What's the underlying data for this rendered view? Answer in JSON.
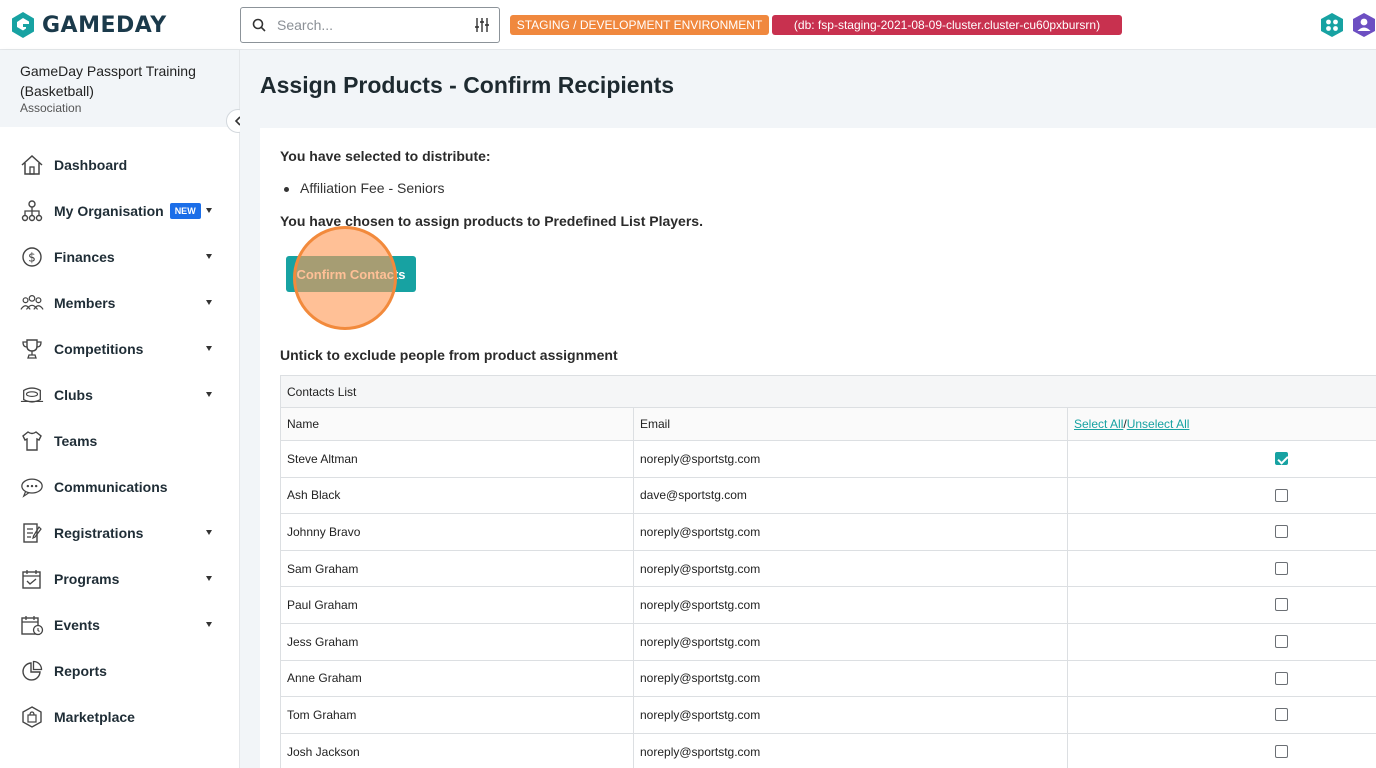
{
  "app": {
    "logo_text": "GAMEDAY"
  },
  "search": {
    "placeholder": "Search..."
  },
  "env": {
    "environment_label": "STAGING / DEVELOPMENT ENVIRONMENT",
    "db_label": "(db: fsp-staging-2021-08-09-cluster.cluster-cu60pxbursrn)"
  },
  "org": {
    "name": "GameDay Passport Training (Basketball)",
    "type": "Association"
  },
  "sidebar": {
    "items": [
      {
        "label": "Dashboard",
        "icon": "home-icon",
        "has_caret": false
      },
      {
        "label": "My Organisation",
        "icon": "org-chart-icon",
        "has_caret": true,
        "badge": "NEW"
      },
      {
        "label": "Finances",
        "icon": "dollar-circle-icon",
        "has_caret": true
      },
      {
        "label": "Members",
        "icon": "members-icon",
        "has_caret": true
      },
      {
        "label": "Competitions",
        "icon": "trophy-icon",
        "has_caret": true
      },
      {
        "label": "Clubs",
        "icon": "stadium-icon",
        "has_caret": true
      },
      {
        "label": "Teams",
        "icon": "jersey-icon",
        "has_caret": false
      },
      {
        "label": "Communications",
        "icon": "chat-icon",
        "has_caret": false
      },
      {
        "label": "Registrations",
        "icon": "registration-icon",
        "has_caret": true
      },
      {
        "label": "Programs",
        "icon": "calendar-icon",
        "has_caret": true
      },
      {
        "label": "Events",
        "icon": "event-calendar-icon",
        "has_caret": true
      },
      {
        "label": "Reports",
        "icon": "pie-chart-icon",
        "has_caret": false
      },
      {
        "label": "Marketplace",
        "icon": "shopping-bag-icon",
        "has_caret": false
      }
    ]
  },
  "main": {
    "title": "Assign Products - Confirm Recipients",
    "selected_text": "You have selected to distribute:",
    "selected_items": [
      "Affiliation Fee - Seniors"
    ],
    "chosen_text": "You have chosen to assign products to Predefined List Players.",
    "confirm_button": "Confirm Contacts",
    "untick_text": "Untick to exclude people from product assignment"
  },
  "contacts_table": {
    "caption": "Contacts List",
    "headers": {
      "name": "Name",
      "email": "Email",
      "select_all": "Select All",
      "separator": "/",
      "unselect_all": "Unselect All"
    },
    "rows": [
      {
        "name": "Steve Altman",
        "email": "noreply@sportstg.com",
        "checked": true
      },
      {
        "name": "Ash Black",
        "email": "dave@sportstg.com",
        "checked": false
      },
      {
        "name": "Johnny Bravo",
        "email": "noreply@sportstg.com",
        "checked": false
      },
      {
        "name": "Sam Graham",
        "email": "noreply@sportstg.com",
        "checked": false
      },
      {
        "name": "Paul Graham",
        "email": "noreply@sportstg.com",
        "checked": false
      },
      {
        "name": "Jess Graham",
        "email": "noreply@sportstg.com",
        "checked": false
      },
      {
        "name": "Anne Graham",
        "email": "noreply@sportstg.com",
        "checked": false
      },
      {
        "name": "Tom Graham",
        "email": "noreply@sportstg.com",
        "checked": false
      },
      {
        "name": "Josh Jackson",
        "email": "noreply@sportstg.com",
        "checked": false
      }
    ]
  },
  "colors": {
    "accent": "#17a2a2",
    "env_orange": "#f0883e",
    "env_red": "#c8314f",
    "new_badge": "#1b6ee8"
  }
}
